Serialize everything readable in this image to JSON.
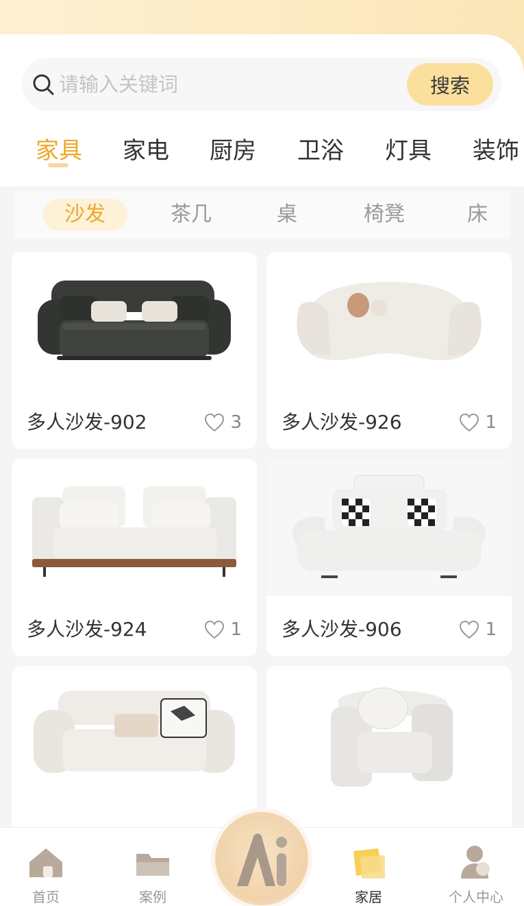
{
  "search": {
    "placeholder": "请输入关键词",
    "button_label": "搜索",
    "icon": "search-icon"
  },
  "categories": [
    {
      "label": "家具",
      "active": true
    },
    {
      "label": "家电",
      "active": false
    },
    {
      "label": "厨房",
      "active": false
    },
    {
      "label": "卫浴",
      "active": false
    },
    {
      "label": "灯具",
      "active": false
    },
    {
      "label": "装饰",
      "active": false
    }
  ],
  "subcategories": [
    {
      "label": "沙发",
      "active": true
    },
    {
      "label": "茶几",
      "active": false
    },
    {
      "label": "桌",
      "active": false
    },
    {
      "label": "椅凳",
      "active": false
    },
    {
      "label": "床",
      "active": false
    }
  ],
  "products": [
    {
      "title": "多人沙发-902",
      "likes": "3"
    },
    {
      "title": "多人沙发-926",
      "likes": "1"
    },
    {
      "title": "多人沙发-924",
      "likes": "1"
    },
    {
      "title": "多人沙发-906",
      "likes": "1"
    },
    {
      "title": "",
      "likes": ""
    },
    {
      "title": "",
      "likes": ""
    }
  ],
  "tabbar": {
    "items": [
      {
        "label": "首页",
        "icon": "home-icon",
        "active": false
      },
      {
        "label": "案例",
        "icon": "folder-icon",
        "active": false
      },
      {
        "label": "家居",
        "icon": "furniture-icon",
        "active": true
      },
      {
        "label": "个人中心",
        "icon": "user-icon",
        "active": false
      }
    ],
    "ai_icon": "ai-icon"
  },
  "colors": {
    "accent": "#f0a72a",
    "search_button": "#fbdf9c",
    "header_gradient": "#fbe6b8"
  }
}
